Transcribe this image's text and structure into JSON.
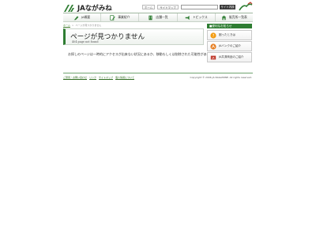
{
  "header": {
    "logo_text": "JAながみね",
    "links": [
      "ホーム",
      "サイトマップ"
    ],
    "search_button": "サイト内検索"
  },
  "nav": [
    {
      "label": "JA概要",
      "icon": "pen-icon"
    },
    {
      "label": "事業紹介",
      "icon": "document-pen-icon"
    },
    {
      "label": "店舗一覧",
      "icon": "building-icon"
    },
    {
      "label": "トピックス",
      "icon": "megaphone-icon"
    },
    {
      "label": "販売所一覧表",
      "icon": "shop-icon"
    }
  ],
  "breadcrumb": {
    "home": "ホーム",
    "separator": ">",
    "current": "ページが見つかりません"
  },
  "main": {
    "title": "ページが見つかりません",
    "subtitle": "404 page not found",
    "message": "お探しのページは一時的にアクセスが出来ない状況にあるか、移動もしくは削除された可能性があります。"
  },
  "sidebar": {
    "header": "■便利なお知らせ",
    "banners": [
      {
        "label": "困ったときは",
        "icon": "help-icon"
      },
      {
        "label": "JAバンクのご紹介",
        "icon": "ja-bank-icon"
      },
      {
        "label": "JA共済商品のご紹介",
        "icon": "ja-kyosai-icon"
      }
    ]
  },
  "footer": {
    "links": [
      "ご意見・お問い合わせ",
      "リンク",
      "サイトマップ",
      "個人情報について"
    ],
    "copyright": "Copyright © 2006 JA NAGAMINE. All rights reserved."
  },
  "colors": {
    "brand_green": "#2e7d32",
    "link_green": "#2e6b1f",
    "ja_red": "#c0392b"
  }
}
